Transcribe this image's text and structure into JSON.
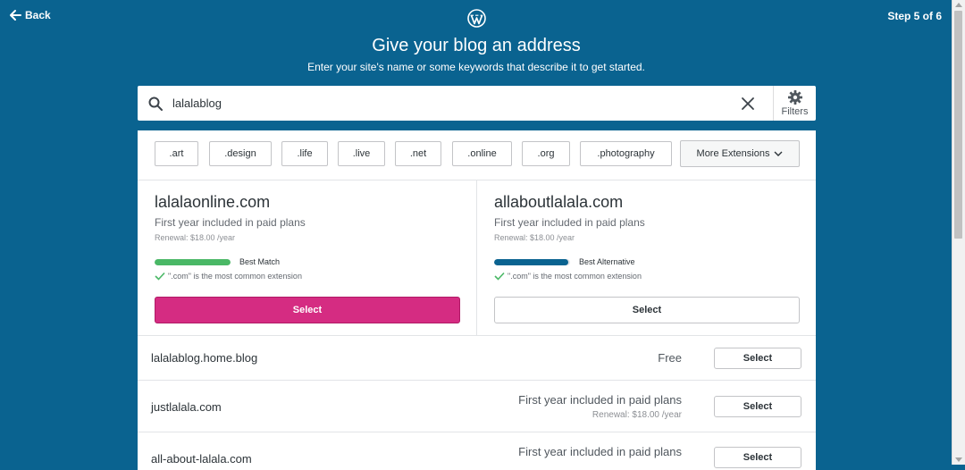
{
  "header": {
    "back_label": "Back",
    "step_label": "Step 5 of 6",
    "title": "Give your blog an address",
    "subtitle": "Enter your site's name or some keywords that describe it to get started."
  },
  "search": {
    "value": "lalalablog",
    "filters_label": "Filters"
  },
  "tlds": [
    ".art",
    ".design",
    ".life",
    ".live",
    ".net",
    ".online",
    ".org",
    ".photography"
  ],
  "more_extensions_label": "More Extensions",
  "featured": [
    {
      "domain": "lalalaonline.com",
      "price_note": "First year included in paid plans",
      "renewal": "Renewal: $18.00 /year",
      "match_label": "Best Match",
      "match_fraction": 1.0,
      "match_color": "#4ab866",
      "ext_note": "\".com\" is the most common extension",
      "select_label": "Select"
    },
    {
      "domain": "allaboutlalala.com",
      "price_note": "First year included in paid plans",
      "renewal": "Renewal: $18.00 /year",
      "match_label": "Best Alternative",
      "match_fraction": 0.98,
      "match_color": "#0a6390",
      "ext_note": "\".com\" is the most common extension",
      "select_label": "Select"
    }
  ],
  "results": [
    {
      "domain": "lalalablog.home.blog",
      "price": "Free",
      "renewal": "",
      "select_label": "Select"
    },
    {
      "domain": "justlalala.com",
      "price": "First year included in paid plans",
      "renewal": "Renewal: $18.00 /year",
      "select_label": "Select"
    },
    {
      "domain": "all-about-lalala.com",
      "price": "First year included in paid plans",
      "renewal": "",
      "select_label": "Select"
    }
  ],
  "colors": {
    "background": "#0a6390",
    "primary_button": "#d52c82",
    "check": "#4ab866"
  }
}
